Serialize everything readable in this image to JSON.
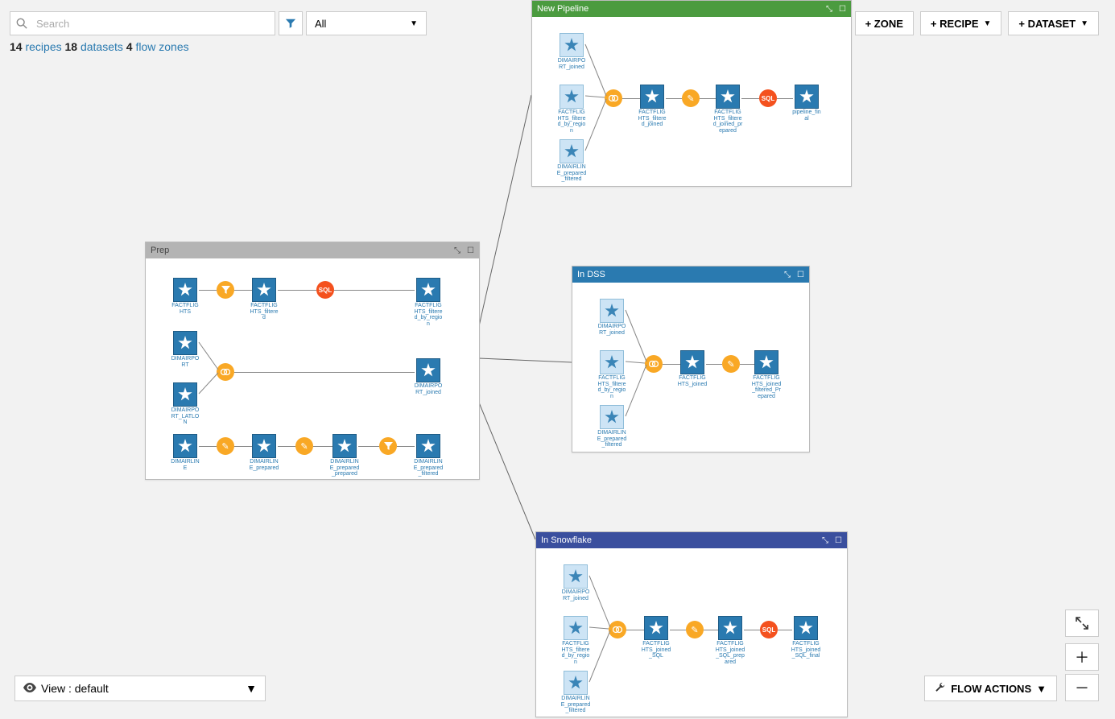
{
  "search": {
    "placeholder": "Search"
  },
  "filter_dd": "All",
  "summary": {
    "recipes": 14,
    "recipes_lbl": "recipes",
    "datasets": 18,
    "datasets_lbl": "datasets",
    "zones": 4,
    "zones_lbl": "flow zones"
  },
  "buttons": {
    "zone": "+ ZONE",
    "recipe": "+ RECIPE",
    "dataset": "+ DATASET",
    "flow_actions": "FLOW ACTIONS"
  },
  "view": {
    "label": "View : default"
  },
  "zones": {
    "prep": {
      "title": "Prep",
      "nodes": {
        "a1": "FACTFLIGHTS",
        "a2": "FACTFLIGHTS_filtered",
        "a3": "FACTFLIGHTS_filtered_by_region",
        "b1": "DIMAIRPORT",
        "b2": "DIMAIRPORT_LATLON",
        "b3": "DIMAIRPORT_joined",
        "c1": "DIMAIRLINE",
        "c2": "DIMAIRLINE_prepared",
        "c3": "DIMAIRLINE_prepared_prepared",
        "c4": "DIMAIRLINE_prepared_filtered"
      }
    },
    "new_pipeline": {
      "title": "New Pipeline",
      "nodes": {
        "g1": "DIMAIRPORT_joined",
        "g2": "FACTFLIGHTS_filtered_by_region",
        "g3": "DIMAIRLINE_prepared_filtered",
        "j1": "FACTFLIGHTS_filtered_joined",
        "j2": "FACTFLIGHTS_filtered_joined_prepared",
        "j3": "pipeline_final"
      }
    },
    "in_dss": {
      "title": "In DSS",
      "nodes": {
        "g1": "DIMAIRPORT_joined",
        "g2": "FACTFLIGHTS_filtered_by_region",
        "g3": "DIMAIRLINE_prepared_filtered",
        "j1": "FACTFLIGHTS_joined",
        "j2": "FACTFLIGHTS_joined_filtered_Prepared"
      }
    },
    "in_snowflake": {
      "title": "In Snowflake",
      "nodes": {
        "g1": "DIMAIRPORT_joined",
        "g2": "FACTFLIGHTS_filtered_by_region",
        "g3": "DIMAIRLINE_prepared_filtered",
        "j1": "FACTFLIGHTS_joined_SQL",
        "j2": "FACTFLIGHTS_joined_SQL_prepared",
        "j3": "FACTFLIGHTS_joined_SQL_final"
      }
    }
  },
  "recipe_icons": {
    "filter": "funnel",
    "join": "rings",
    "prepare": "broom",
    "sql": "SQL"
  },
  "colors": {
    "orange": "#f9a825",
    "sql": "#f4511e",
    "dataset": "#2a7ab0",
    "ghost": "#cde4f5",
    "green": "#4b9b3f",
    "navy": "#3a4f9e"
  }
}
